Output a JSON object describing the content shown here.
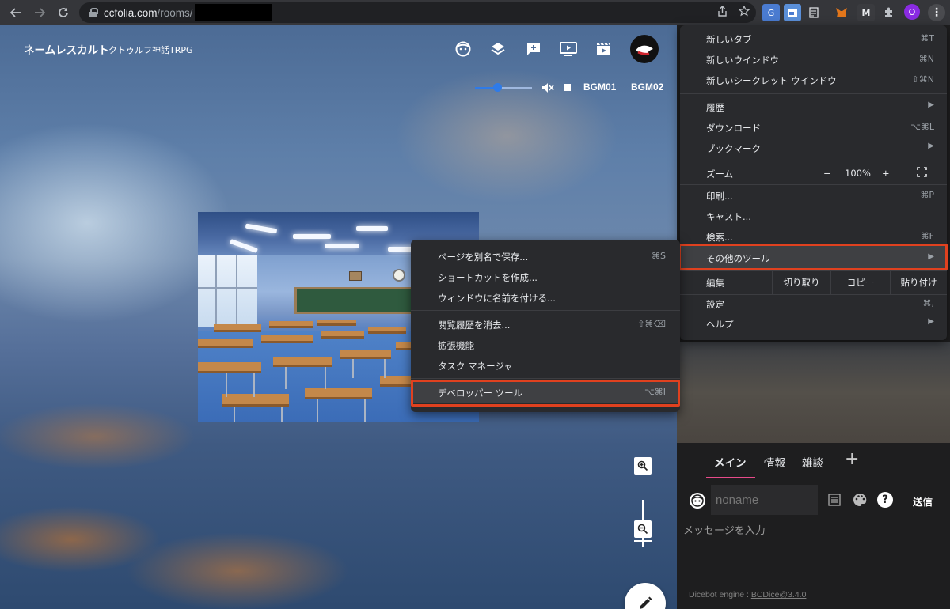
{
  "browser": {
    "url_host": "ccfolia.com",
    "url_path": "/rooms/",
    "profile_initial": "O"
  },
  "app": {
    "room_title": "ネームレスカルト",
    "room_subtitle": "クトゥルフ神話TRPG",
    "toolbar_icons": [
      "character-face-icon",
      "layers-icon",
      "add-comment-icon",
      "screen-play-icon",
      "scene-clapper-icon"
    ],
    "bgm": {
      "volume": 0.4,
      "track1": "BGM01",
      "track2": "BGM02"
    }
  },
  "chat": {
    "tabs": [
      "メイン",
      "情報",
      "雑談"
    ],
    "add_tab": "+",
    "name_placeholder": "noname",
    "send_label": "送信",
    "message_placeholder": "メッセージを入力",
    "engine_prefix": "Dicebot engine : ",
    "engine_link": "BCDice@3.4.0"
  },
  "menu": {
    "new_tab": "新しいタブ",
    "new_tab_sc": "⌘T",
    "new_window": "新しいウインドウ",
    "new_window_sc": "⌘N",
    "new_incognito": "新しいシークレット ウインドウ",
    "new_incognito_sc": "⇧⌘N",
    "history": "履歴",
    "downloads": "ダウンロード",
    "downloads_sc": "⌥⌘L",
    "bookmarks": "ブックマーク",
    "zoom": "ズーム",
    "zoom_minus": "−",
    "zoom_value": "100%",
    "zoom_plus": "+",
    "print": "印刷...",
    "print_sc": "⌘P",
    "cast": "キャスト...",
    "search": "検索...",
    "search_sc": "⌘F",
    "more_tools": "その他のツール",
    "edit": "編集",
    "cut": "切り取り",
    "copy": "コピー",
    "paste": "貼り付け",
    "settings": "設定",
    "settings_sc": "⌘,",
    "help": "ヘルプ"
  },
  "submenu": {
    "save_as": "ページを別名で保存...",
    "save_as_sc": "⌘S",
    "create_shortcut": "ショートカットを作成...",
    "name_window": "ウィンドウに名前を付ける...",
    "clear_history": "閲覧履歴を消去...",
    "clear_history_sc": "⇧⌘⌫",
    "extensions": "拡張機能",
    "task_manager": "タスク マネージャ",
    "dev_tools": "デベロッパー ツール",
    "dev_tools_sc": "⌥⌘I"
  },
  "colors": {
    "highlight_border": "#e0411f",
    "accent_pink": "#e84b8a",
    "slider_blue": "#2f7be8"
  }
}
